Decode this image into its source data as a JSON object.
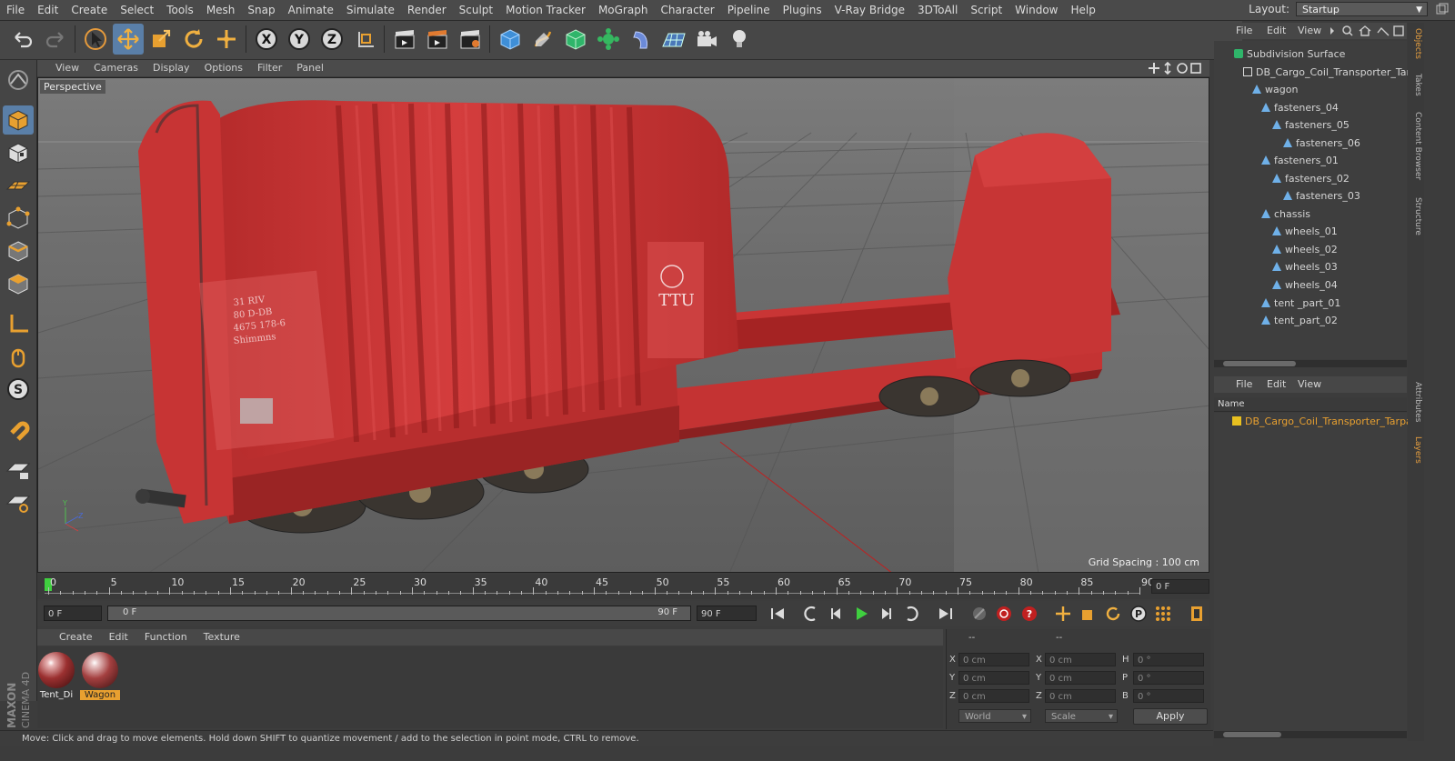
{
  "menubar": {
    "items": [
      "File",
      "Edit",
      "Create",
      "Select",
      "Tools",
      "Mesh",
      "Snap",
      "Animate",
      "Simulate",
      "Render",
      "Sculpt",
      "Motion Tracker",
      "MoGraph",
      "Character",
      "Pipeline",
      "Plugins",
      "V-Ray Bridge",
      "3DToAll",
      "Script",
      "Window",
      "Help"
    ],
    "layout_label": "Layout:",
    "layout_value": "Startup"
  },
  "toolbar": {
    "axis_x": "X",
    "axis_y": "Y",
    "axis_z": "Z"
  },
  "viewport": {
    "menu": [
      "View",
      "Cameras",
      "Display",
      "Options",
      "Filter",
      "Panel"
    ],
    "camera_label": "Perspective",
    "grid_spacing": "Grid Spacing : 100 cm",
    "model_labels": {
      "ttu": "TTU",
      "plate_text": "31 RIV\n80 D-DB\n4675 178-6\nShimmns"
    }
  },
  "timeline": {
    "ticks": [
      "0",
      "5",
      "10",
      "15",
      "20",
      "25",
      "30",
      "35",
      "40",
      "45",
      "50",
      "55",
      "60",
      "65",
      "70",
      "75",
      "80",
      "85",
      "90"
    ],
    "end_field": "0 F"
  },
  "transport": {
    "current_frame": "0 F",
    "slider_start": "0 F",
    "slider_end": "90 F",
    "max_frame": "90 F"
  },
  "materials": {
    "menu": [
      "Create",
      "Edit",
      "Function",
      "Texture"
    ],
    "items": [
      {
        "name": "Tent_Di",
        "selected": false
      },
      {
        "name": "Wagon",
        "selected": true
      }
    ]
  },
  "coordinates": {
    "header": "--",
    "header2": "--",
    "rows": [
      {
        "a": "X",
        "av": "0 cm",
        "b": "X",
        "bv": "0 cm",
        "c": "H",
        "cv": "0 °"
      },
      {
        "a": "Y",
        "av": "0 cm",
        "b": "Y",
        "bv": "0 cm",
        "c": "P",
        "cv": "0 °"
      },
      {
        "a": "Z",
        "av": "0 cm",
        "b": "Z",
        "bv": "0 cm",
        "c": "B",
        "cv": "0 °"
      }
    ],
    "space": "World",
    "mode": "Scale",
    "apply": "Apply"
  },
  "status": "Move: Click and drag to move elements. Hold down SHIFT to quantize movement / add to the selection in point mode, CTRL to remove.",
  "objects": {
    "menu": [
      "File",
      "Edit",
      "View"
    ],
    "tree": [
      {
        "label": "Subdivision Surface",
        "depth": 0,
        "icon": "subdivision-icon"
      },
      {
        "label": "DB_Cargo_Coil_Transporter_Tarp",
        "depth": 1,
        "icon": "null-icon"
      },
      {
        "label": "wagon",
        "depth": 2,
        "icon": "null-icon"
      },
      {
        "label": "fasteners_04",
        "depth": 3,
        "icon": "polygon-icon"
      },
      {
        "label": "fasteners_05",
        "depth": 4,
        "icon": "polygon-icon"
      },
      {
        "label": "fasteners_06",
        "depth": 5,
        "icon": "polygon-icon"
      },
      {
        "label": "fasteners_01",
        "depth": 3,
        "icon": "polygon-icon"
      },
      {
        "label": "fasteners_02",
        "depth": 4,
        "icon": "polygon-icon"
      },
      {
        "label": "fasteners_03",
        "depth": 5,
        "icon": "polygon-icon"
      },
      {
        "label": "chassis",
        "depth": 3,
        "icon": "polygon-icon"
      },
      {
        "label": "wheels_01",
        "depth": 4,
        "icon": "polygon-icon"
      },
      {
        "label": "wheels_02",
        "depth": 4,
        "icon": "polygon-icon"
      },
      {
        "label": "wheels_03",
        "depth": 4,
        "icon": "polygon-icon"
      },
      {
        "label": "wheels_04",
        "depth": 4,
        "icon": "polygon-icon"
      },
      {
        "label": "tent _part_01",
        "depth": 3,
        "icon": "polygon-icon"
      },
      {
        "label": "tent_part_02",
        "depth": 3,
        "icon": "polygon-icon"
      }
    ]
  },
  "layers": {
    "menu": [
      "File",
      "Edit",
      "View"
    ],
    "column": "Name",
    "items": [
      "DB_Cargo_Coil_Transporter_Tarpa"
    ]
  },
  "sidetabs": {
    "top": [
      "Objects",
      "Takes",
      "Content Browser",
      "Structure"
    ],
    "bottom": [
      "Attributes",
      "Layers"
    ]
  },
  "branding": {
    "line1": "MAXON",
    "line2": "CINEMA 4D"
  },
  "colors": {
    "accent": "#5a7fa8",
    "selected_text": "#e8a030",
    "model_red": "#c93535",
    "layer_yellow": "#e8c020"
  }
}
